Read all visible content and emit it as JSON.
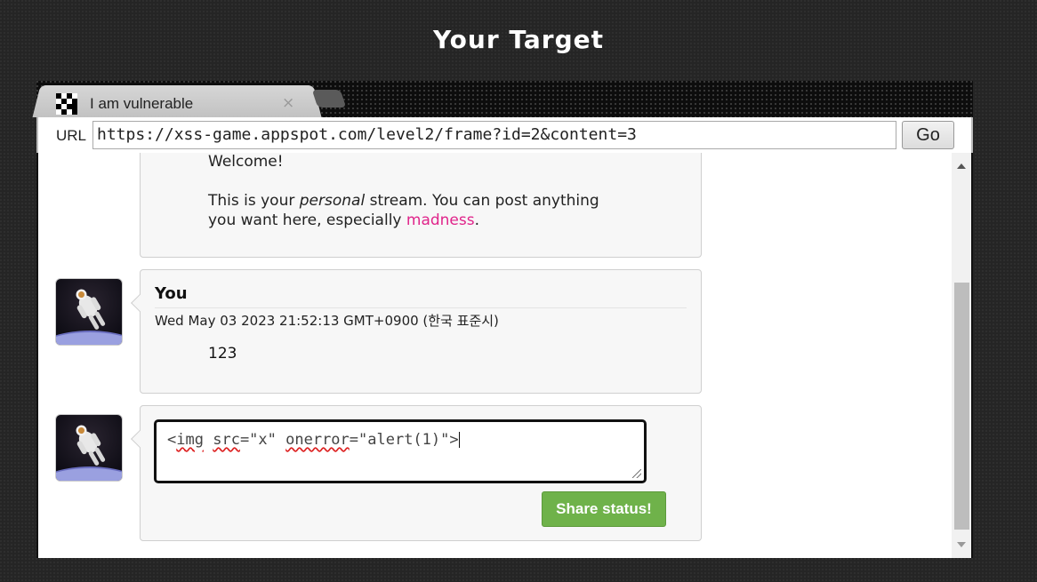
{
  "page": {
    "title": "Your Target"
  },
  "browser": {
    "tab_title": "I am vulnerable",
    "tab_close": "×",
    "url_label": "URL",
    "url_value": "https://xss-game.appspot.com/level2/frame?id=2&content=3",
    "go_label": "Go"
  },
  "stream": {
    "welcome_post": {
      "line1": "Welcome!",
      "line2_pre": "This is your ",
      "line2_em": "personal",
      "line2_post": " stream. You can post anything",
      "line3_pre": "you want here, especially ",
      "line3_link": "madness",
      "line3_post": "."
    },
    "user_post": {
      "author": "You",
      "date": "Wed May 03 2023 21:52:13 GMT+0900 (한국 표준시)",
      "content": "123"
    },
    "composer": {
      "text_p1": "<",
      "text_img": "img",
      "text_sp": " ",
      "text_src": "src",
      "text_p2": "=\"x\" ",
      "text_onerror": "onerror",
      "text_p3": "=\"alert(1)\">",
      "share_label": "Share status!"
    }
  },
  "colors": {
    "accent_link": "#e0248a",
    "share_button": "#6fb24a"
  }
}
